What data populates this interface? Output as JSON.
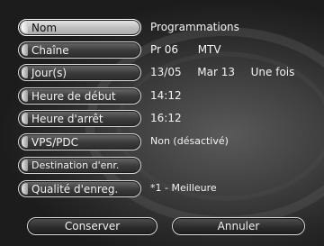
{
  "menu": [
    {
      "label": "Nom",
      "value": "Programmations",
      "active": true
    },
    {
      "label": "Chaîne",
      "value_parts": [
        "Pr 06",
        "MTV"
      ]
    },
    {
      "label": "Jour(s)",
      "value_parts": [
        "13/05",
        "Mar 13",
        "Une fois"
      ]
    },
    {
      "label": "Heure de début",
      "value": "14:12"
    },
    {
      "label": "Heure d'arrêt",
      "value": "16:12"
    },
    {
      "label": "VPS/PDC",
      "value": "Non (désactivé)"
    },
    {
      "label": "Destination d'enr.",
      "value": ""
    },
    {
      "label": "Qualité d'enreg.",
      "value": "*1 - Meilleure"
    }
  ],
  "buttons": {
    "save": "Conserver",
    "cancel": "Annuler"
  },
  "colors": {
    "background": "#2e2e2e",
    "active_row": "#d0d0d0",
    "text": "#f2f2f2"
  }
}
